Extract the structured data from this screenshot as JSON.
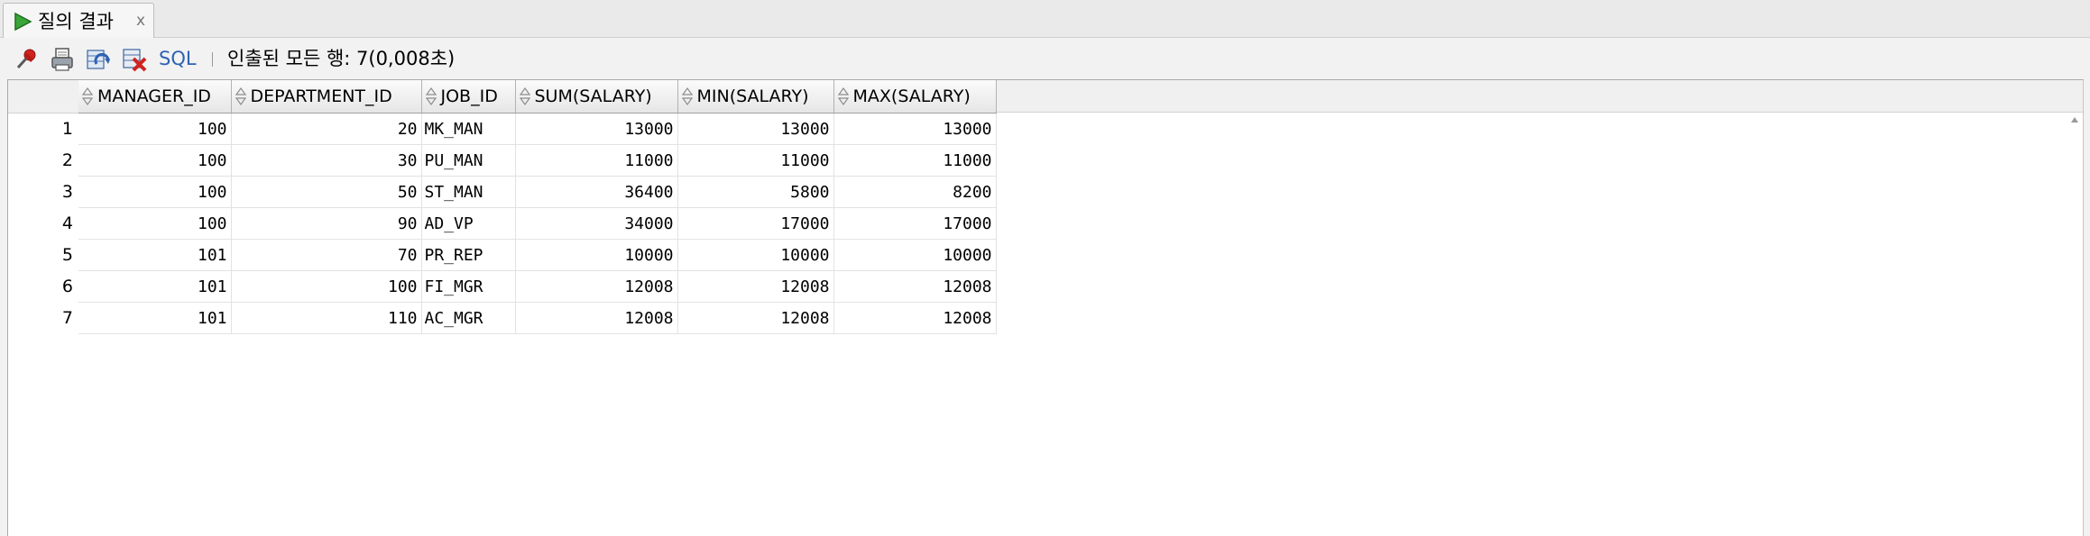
{
  "tab": {
    "title": "질의 결과",
    "close": "x"
  },
  "toolbar": {
    "icons": [
      "pin-icon",
      "print-icon",
      "refresh-icon",
      "cancel-icon"
    ],
    "sql_label": "SQL",
    "status": "인출된 모든 행: 7(0,008초)"
  },
  "grid": {
    "columns": [
      "MANAGER_ID",
      "DEPARTMENT_ID",
      "JOB_ID",
      "SUM(SALARY)",
      "MIN(SALARY)",
      "MAX(SALARY)"
    ],
    "rows": [
      {
        "n": "1",
        "manager_id": "100",
        "department_id": "20",
        "job_id": "MK_MAN",
        "sum": "13000",
        "min": "13000",
        "max": "13000"
      },
      {
        "n": "2",
        "manager_id": "100",
        "department_id": "30",
        "job_id": "PU_MAN",
        "sum": "11000",
        "min": "11000",
        "max": "11000"
      },
      {
        "n": "3",
        "manager_id": "100",
        "department_id": "50",
        "job_id": "ST_MAN",
        "sum": "36400",
        "min": "5800",
        "max": "8200"
      },
      {
        "n": "4",
        "manager_id": "100",
        "department_id": "90",
        "job_id": "AD_VP",
        "sum": "34000",
        "min": "17000",
        "max": "17000"
      },
      {
        "n": "5",
        "manager_id": "101",
        "department_id": "70",
        "job_id": "PR_REP",
        "sum": "10000",
        "min": "10000",
        "max": "10000"
      },
      {
        "n": "6",
        "manager_id": "101",
        "department_id": "100",
        "job_id": "FI_MGR",
        "sum": "12008",
        "min": "12008",
        "max": "12008"
      },
      {
        "n": "7",
        "manager_id": "101",
        "department_id": "110",
        "job_id": "AC_MGR",
        "sum": "12008",
        "min": "12008",
        "max": "12008"
      }
    ]
  },
  "colors": {
    "sql_link": "#2d62b3",
    "run_icon": "#3aa63a",
    "pin_icon": "#d0231f",
    "cancel_icon": "#d0231f"
  }
}
